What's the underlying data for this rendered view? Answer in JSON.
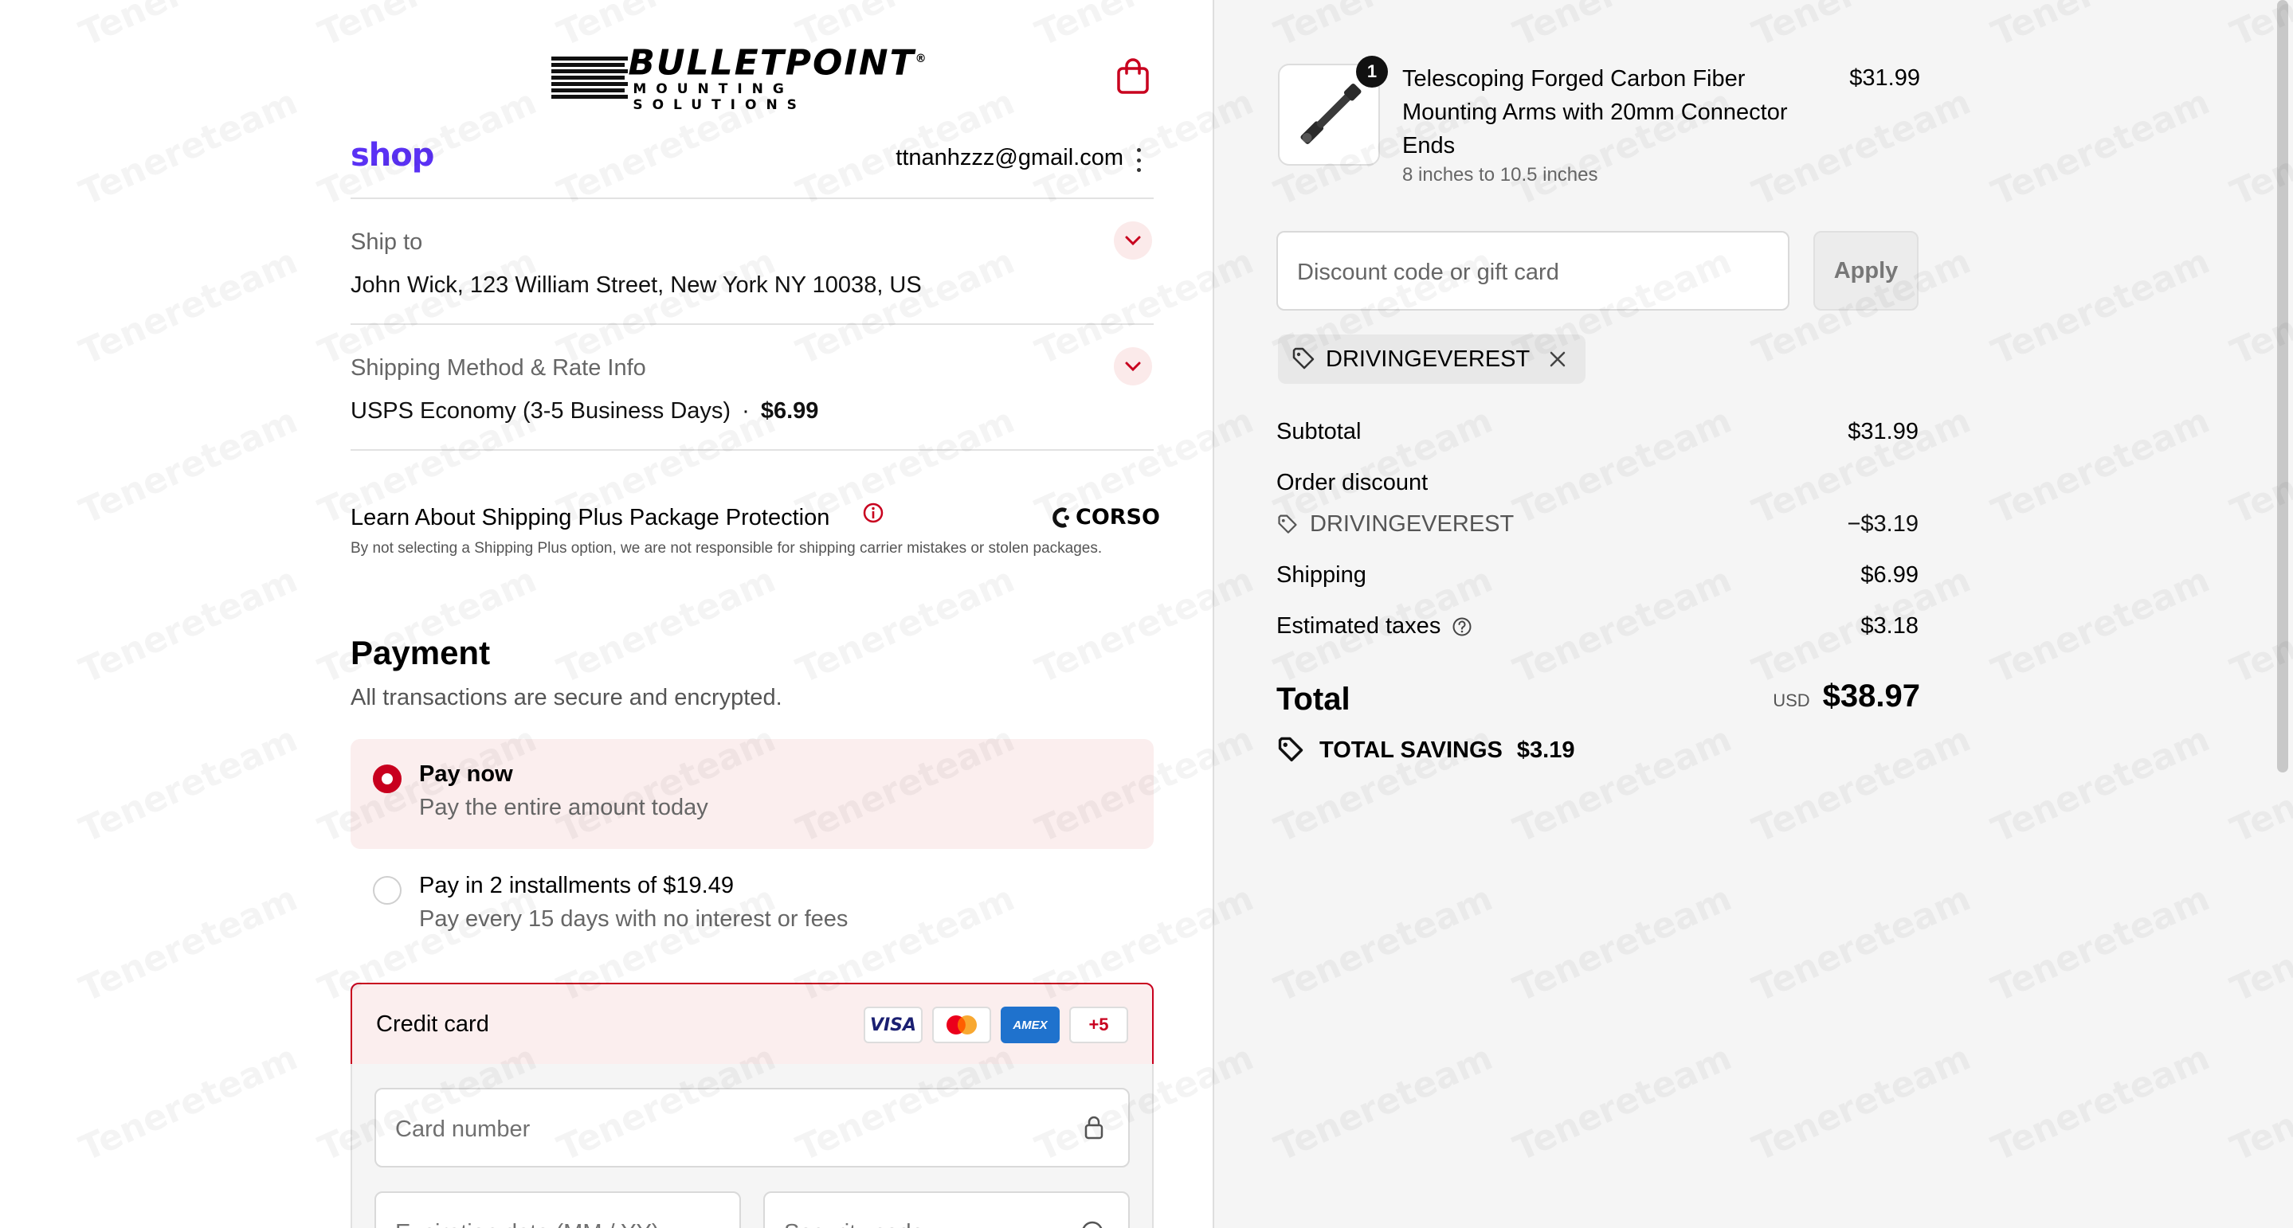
{
  "header": {
    "brand_main": "BULLETPOINT",
    "brand_reg": "®",
    "brand_sub": "MOUNTING SOLUTIONS",
    "shop_logo": "shop",
    "email": "ttnanhzzz@gmail.com"
  },
  "ship_to": {
    "label": "Ship to",
    "value": "John Wick, 123 William Street, New York NY 10038, US"
  },
  "shipping_method": {
    "label": "Shipping Method & Rate Info",
    "value": "USPS Economy (3-5 Business Days)",
    "separator": "·",
    "price": "$6.99"
  },
  "protection": {
    "title": "Learn About Shipping Plus Package Protection",
    "brand": "CORSO",
    "note": "By not selecting a Shipping Plus option, we are not responsible for shipping carrier mistakes or stolen packages."
  },
  "payment": {
    "title": "Payment",
    "subtitle": "All transactions are secure and encrypted.",
    "options": [
      {
        "title": "Pay now",
        "subtitle": "Pay the entire amount today",
        "selected": true
      },
      {
        "title": "Pay in 2 installments of $19.49",
        "subtitle": "Pay every 15 days with no interest or fees",
        "selected": false
      }
    ],
    "credit_card": {
      "label": "Credit card",
      "brands": [
        "VISA",
        "mastercard",
        "AMEX",
        "+5"
      ],
      "card_number_placeholder": "Card number",
      "expiry_placeholder": "Expiration date (MM / YY)",
      "cvv_placeholder": "Security code"
    },
    "accent_color": "#c8001e"
  },
  "summary": {
    "item": {
      "quantity": "1",
      "name": "Telescoping Forged Carbon Fiber Mounting Arms with 20mm Connector Ends",
      "variant": "8 inches to 10.5 inches",
      "price": "$31.99"
    },
    "discount_placeholder": "Discount code or gift card",
    "apply_label": "Apply",
    "applied_code": "DRIVINGEVEREST",
    "subtotal_label": "Subtotal",
    "subtotal_value": "$31.99",
    "order_discount_label": "Order discount",
    "discount_code": "DRIVINGEVEREST",
    "discount_value": "−$3.19",
    "shipping_label": "Shipping",
    "shipping_value": "$6.99",
    "taxes_label": "Estimated taxes",
    "taxes_value": "$3.18",
    "total_label": "Total",
    "total_currency": "USD",
    "total_value": "$38.97",
    "savings_label": "TOTAL SAVINGS",
    "savings_value": "$3.19"
  },
  "watermark": "Tenereteam"
}
